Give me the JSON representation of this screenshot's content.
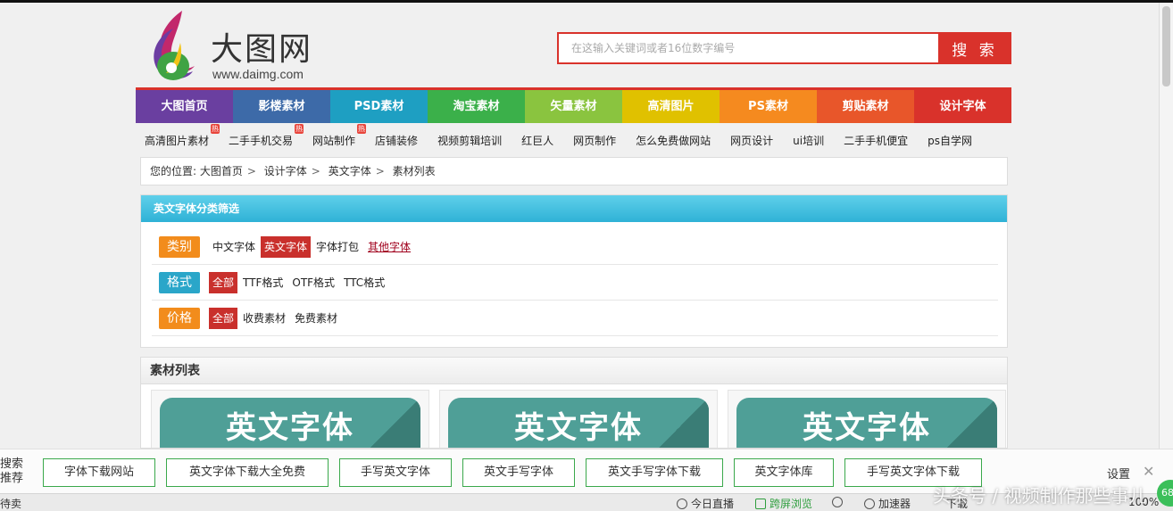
{
  "header": {
    "logo_text": "大图网",
    "logo_url": "www.daimg.com",
    "search_placeholder": "在这输入关键词或者16位数字编号",
    "search_button": "搜 索"
  },
  "nav": [
    {
      "label": "大图首页",
      "color": "#6a3fa0"
    },
    {
      "label": "影楼素材",
      "color": "#3d6aa8"
    },
    {
      "label": "PSD素材",
      "color": "#1e9fc2"
    },
    {
      "label": "淘宝素材",
      "color": "#3bb04a"
    },
    {
      "label": "矢量素材",
      "color": "#8ac43f"
    },
    {
      "label": "高清图片",
      "color": "#e0c100"
    },
    {
      "label": "PS素材",
      "color": "#f58a1f"
    },
    {
      "label": "剪贴素材",
      "color": "#e8562a"
    },
    {
      "label": "设计字体",
      "color": "#d9322b"
    }
  ],
  "hotlinks": [
    {
      "label": "高清图片素材",
      "hot": "热"
    },
    {
      "label": "二手手机交易",
      "hot": "热"
    },
    {
      "label": "网站制作",
      "hot": "热"
    },
    {
      "label": "店铺装修",
      "hot": ""
    },
    {
      "label": "视频剪辑培训",
      "hot": ""
    },
    {
      "label": "红巨人",
      "hot": ""
    },
    {
      "label": "网页制作",
      "hot": ""
    },
    {
      "label": "怎么免费做网站",
      "hot": ""
    },
    {
      "label": "网页设计",
      "hot": ""
    },
    {
      "label": "ui培训",
      "hot": ""
    },
    {
      "label": "二手手机便宜",
      "hot": ""
    },
    {
      "label": "ps自学网",
      "hot": ""
    }
  ],
  "breadcrumb": {
    "prefix": "您的位置:",
    "items": [
      "大图首页",
      "设计字体",
      "英文字体",
      "素材列表"
    ]
  },
  "filter": {
    "title": "英文字体分类筛选",
    "rows": [
      {
        "label": "类别",
        "color": "#f28c1c",
        "options": [
          {
            "text": "中文字体",
            "state": "normal"
          },
          {
            "text": "英文字体",
            "state": "selected"
          },
          {
            "text": "字体打包",
            "state": "normal"
          },
          {
            "text": "其他字体",
            "state": "link"
          }
        ]
      },
      {
        "label": "格式",
        "color": "#2aa6c9",
        "options": [
          {
            "text": "全部",
            "state": "selected"
          },
          {
            "text": "TTF格式",
            "state": "normal"
          },
          {
            "text": "OTF格式",
            "state": "normal"
          },
          {
            "text": "TTC格式",
            "state": "normal"
          }
        ]
      },
      {
        "label": "价格",
        "color": "#f28c1c",
        "options": [
          {
            "text": "全部",
            "state": "selected"
          },
          {
            "text": "收费素材",
            "state": "normal"
          },
          {
            "text": "免费素材",
            "state": "normal"
          }
        ]
      }
    ]
  },
  "material_list": {
    "title": "素材列表",
    "cards": [
      {
        "title": "英文字体"
      },
      {
        "title": "英文字体"
      },
      {
        "title": "英文字体"
      }
    ]
  },
  "recommend": {
    "title": "搜索推荐",
    "chips": [
      "字体下载网站",
      "英文字体下载大全免费",
      "手写英文字体",
      "英文手写字体",
      "英文手写字体下载",
      "英文字体库",
      "手写英文字体下载"
    ],
    "settings": "设置",
    "close": "✕"
  },
  "statusbar": {
    "left": "待卖",
    "live": "今日直播",
    "cross": "跨屏浏览",
    "accelerator": "加速器",
    "download": "下载",
    "zoom": "100%",
    "badge": "68"
  },
  "watermark": "头条号 / 视频制作那些事儿"
}
